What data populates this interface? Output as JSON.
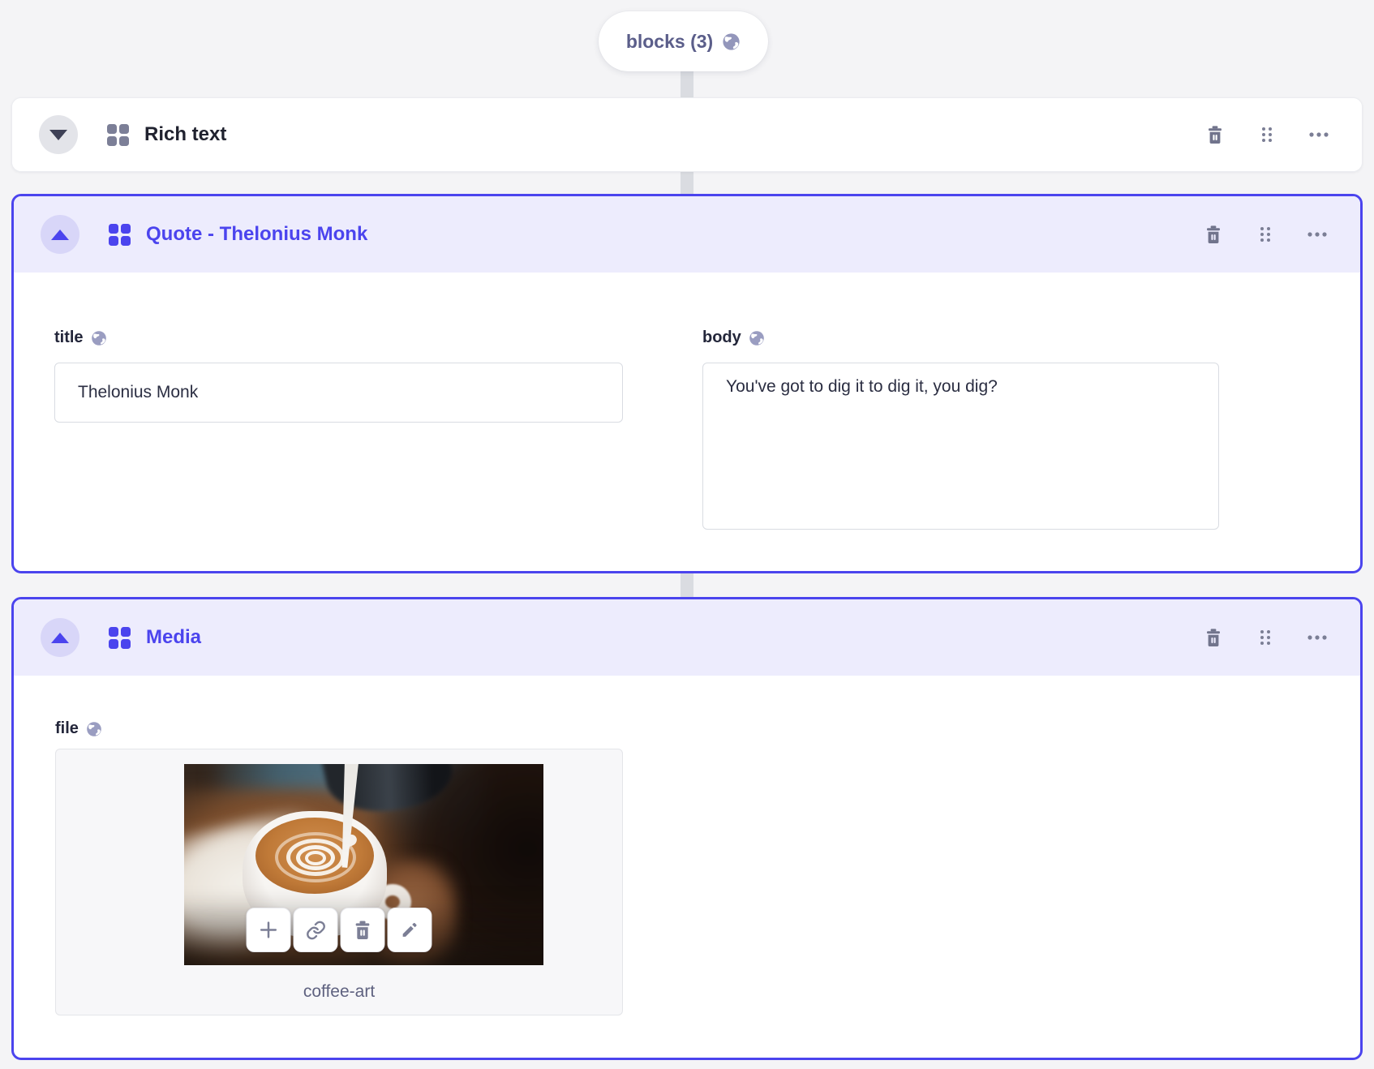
{
  "pill": {
    "label": "blocks (3)"
  },
  "blocks": [
    {
      "title": "Rich text",
      "collapsed": true
    },
    {
      "title": "Quote - Thelonius Monk",
      "collapsed": false,
      "fields": {
        "title": {
          "label": "title",
          "value": "Thelonius Monk"
        },
        "body": {
          "label": "body",
          "value": "You've got to dig it to dig it, you dig?"
        }
      }
    },
    {
      "title": "Media",
      "collapsed": false,
      "fields": {
        "file": {
          "label": "file",
          "filename": "coffee-art"
        }
      }
    }
  ],
  "colors": {
    "accent": "#4b44ee",
    "active_header_bg": "#edecfd",
    "page_bg": "#f4f4f6",
    "icon_gray": "#7b7e95",
    "label_text": "#23263a"
  },
  "icons": {
    "globe": "globe-icon",
    "grid": "block-type-grid-icon",
    "collapse_down": "triangle-down-icon",
    "collapse_up": "triangle-up-icon",
    "trash": "trash-icon",
    "drag": "drag-handle-icon",
    "more": "ellipsis-icon",
    "plus": "plus-icon",
    "link": "link-icon",
    "edit": "pencil-icon"
  }
}
